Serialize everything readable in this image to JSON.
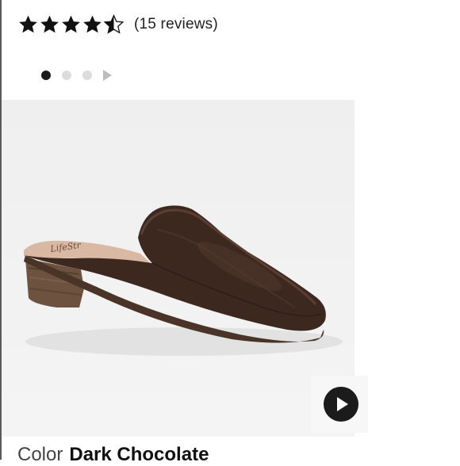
{
  "rating": {
    "value": 4.5,
    "max": 5,
    "review_count_text": "(15 reviews)"
  },
  "carousel": {
    "total_dots": 3,
    "active_index": 0
  },
  "product": {
    "image_description_icon": "shoe-mule-image"
  },
  "video": {
    "icon": "play-icon"
  },
  "color": {
    "label": "Color",
    "value": "Dark Chocolate"
  },
  "colors": {
    "star": "#111111",
    "dot_active": "#1a1a1a",
    "dot_inactive": "#dcdcdc",
    "image_bg": "#f0f0f0",
    "shoe": "#3e2a22"
  }
}
